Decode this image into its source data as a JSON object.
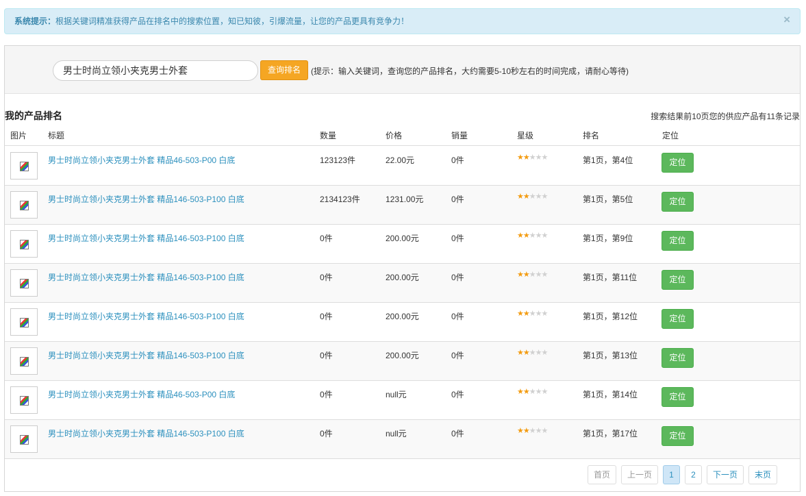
{
  "alert": {
    "title": "系统提示：",
    "message": "根据关键词精准获得产品在排名中的搜索位置，知已知彼，引爆流量，让您的产品更具有竞争力！",
    "close_glyph": "×"
  },
  "search": {
    "value": "男士时尚立领小夹克男士外套",
    "button_label": "查询排名",
    "hint": "(提示：输入关键词，查询您的产品排名，大约需要5-10秒左右的时间完成，请耐心等待)"
  },
  "section": {
    "title": "我的产品排名",
    "summary": "搜索结果前10页您的供应产品有11条记录"
  },
  "table": {
    "headers": {
      "image": "图片",
      "title": "标题",
      "quantity": "数量",
      "price": "价格",
      "sales": "销量",
      "stars": "星级",
      "rank": "排名",
      "locate": "定位"
    },
    "rows": [
      {
        "title": "男士时尚立领小夹克男士外套 精品46-503-P00 白底",
        "quantity": "123123件",
        "price": "22.00元",
        "sales": "0件",
        "stars": 2,
        "rank": "第1页，第4位",
        "button": "定位"
      },
      {
        "title": "男士时尚立领小夹克男士外套 精品146-503-P100 白底",
        "quantity": "2134123件",
        "price": "1231.00元",
        "sales": "0件",
        "stars": 2,
        "rank": "第1页，第5位",
        "button": "定位"
      },
      {
        "title": "男士时尚立领小夹克男士外套 精品146-503-P100 白底",
        "quantity": "0件",
        "price": "200.00元",
        "sales": "0件",
        "stars": 2,
        "rank": "第1页，第9位",
        "button": "定位"
      },
      {
        "title": "男士时尚立领小夹克男士外套 精品146-503-P100 白底",
        "quantity": "0件",
        "price": "200.00元",
        "sales": "0件",
        "stars": 2,
        "rank": "第1页，第11位",
        "button": "定位"
      },
      {
        "title": "男士时尚立领小夹克男士外套 精品146-503-P100 白底",
        "quantity": "0件",
        "price": "200.00元",
        "sales": "0件",
        "stars": 2,
        "rank": "第1页，第12位",
        "button": "定位"
      },
      {
        "title": "男士时尚立领小夹克男士外套 精品146-503-P100 白底",
        "quantity": "0件",
        "price": "200.00元",
        "sales": "0件",
        "stars": 2,
        "rank": "第1页，第13位",
        "button": "定位"
      },
      {
        "title": "男士时尚立领小夹克男士外套 精品46-503-P00 白底",
        "quantity": "0件",
        "price": "null元",
        "sales": "0件",
        "stars": 2,
        "rank": "第1页，第14位",
        "button": "定位"
      },
      {
        "title": "男士时尚立领小夹克男士外套 精品146-503-P100 白底",
        "quantity": "0件",
        "price": "null元",
        "sales": "0件",
        "stars": 2,
        "rank": "第1页，第17位",
        "button": "定位"
      }
    ],
    "max_stars": 5
  },
  "pagination": {
    "first": "首页",
    "prev": "上一页",
    "pages": [
      "1",
      "2"
    ],
    "current": "1",
    "next": "下一页",
    "last": "末页"
  },
  "colors": {
    "alert_bg": "#d9edf7",
    "link": "#2a8fbd",
    "search_button": "#f5a623",
    "locate_button": "#5cb85c",
    "star_on": "#f39c12",
    "star_off": "#d0d0d0"
  }
}
